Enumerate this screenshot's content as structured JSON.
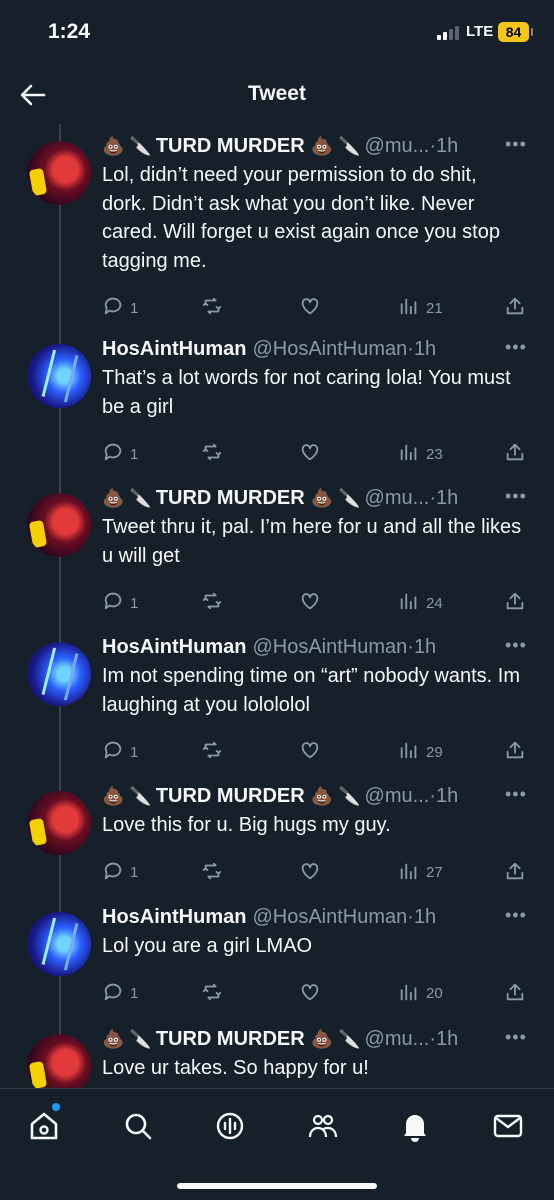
{
  "status": {
    "time": "1:24",
    "network": "LTE",
    "battery": "84"
  },
  "header": {
    "title": "Tweet"
  },
  "tweets": [
    {
      "author": "TURD MURDER",
      "emoji_left": "💩 🔪",
      "emoji_right": "💩 🔪",
      "handle": "@mu...",
      "age": "1h",
      "avatar": "red-mask-avatar",
      "text": "Lol, didn’t need your permission to do shit, dork. Didn’t ask what you don’t like. Never cared. Will forget u exist again once you stop tagging me.",
      "replies": "1",
      "views": "21"
    },
    {
      "author": "HosAintHuman",
      "emoji_left": "",
      "emoji_right": "",
      "handle": "@HosAintHuman",
      "age": "1h",
      "avatar": "blue-neon-avatar",
      "text": "That’s a lot words for not caring lola! You must be a girl",
      "replies": "1",
      "views": "23"
    },
    {
      "author": "TURD MURDER",
      "emoji_left": "💩 🔪",
      "emoji_right": "💩 🔪",
      "handle": "@mu...",
      "age": "1h",
      "avatar": "red-mask-avatar",
      "text": "Tweet thru it, pal. I’m here for u and all the likes u will get",
      "replies": "1",
      "views": "24"
    },
    {
      "author": "HosAintHuman",
      "emoji_left": "",
      "emoji_right": "",
      "handle": "@HosAintHuman",
      "age": "1h",
      "avatar": "blue-neon-avatar",
      "text": "Im not spending time on “art” nobody wants. Im laughing at you lolololol",
      "replies": "1",
      "views": "29"
    },
    {
      "author": "TURD MURDER",
      "emoji_left": "💩 🔪",
      "emoji_right": "💩 🔪",
      "handle": "@mu...",
      "age": "1h",
      "avatar": "red-mask-avatar",
      "text": "Love this for u. Big hugs my guy.",
      "replies": "1",
      "views": "27"
    },
    {
      "author": "HosAintHuman",
      "emoji_left": "",
      "emoji_right": "",
      "handle": "@HosAintHuman",
      "age": "1h",
      "avatar": "blue-neon-avatar",
      "text": "Lol you are a girl LMAO",
      "replies": "1",
      "views": "20"
    },
    {
      "author": "TURD MURDER",
      "emoji_left": "💩 🔪",
      "emoji_right": "💩 🔪",
      "handle": "@mu...",
      "age": "1h",
      "avatar": "red-mask-avatar",
      "text": "Love ur takes. So happy for u!",
      "replies": "",
      "views": ""
    }
  ],
  "tabbar": {
    "items": [
      "home-icon",
      "search-icon",
      "spaces-icon",
      "communities-icon",
      "notifications-icon",
      "messages-icon"
    ],
    "notification_dot_color": "#1d9bf0"
  },
  "colors": {
    "background": "#15202b",
    "text": "#f7f9f9",
    "muted": "#8b98a5",
    "accent": "#1d9bf0"
  }
}
